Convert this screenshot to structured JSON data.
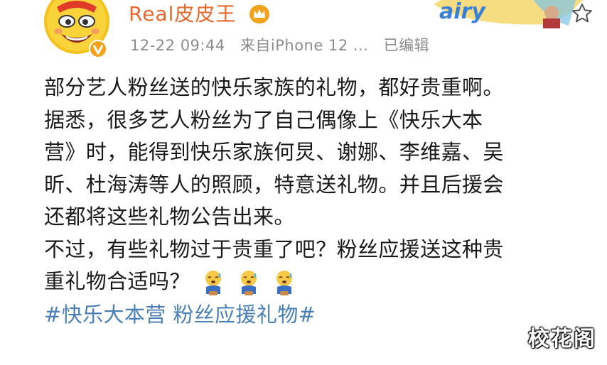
{
  "post": {
    "author": {
      "name": "Real皮皮王",
      "avatar_icon": "cartoon-face-avatar",
      "badge_icon": "verified-badge",
      "member_icon": "crown-icon",
      "name_color": "#e8692e"
    },
    "meta": {
      "datetime": "12-22 09:44",
      "source": "来自iPhone 12 ...",
      "edited": "已编辑"
    },
    "banner_text": "airy",
    "lines": [
      "部分艺人粉丝送的快乐家族的礼物，都好贵重啊。",
      "据悉，很多艺人粉丝为了自己偶像上《快乐大本",
      "营》时，能得到快乐家族何炅、谢娜、李维嘉、吴",
      "昕、杜海涛等人的照顾，特意送礼物。并且后援会",
      "还都将这些礼物公告出来。",
      "不过，有些礼物过于贵重了吧？粉丝应援送这种贵",
      "重礼物合适吗？"
    ],
    "emojis": [
      "sweating-emoji",
      "sweating-emoji",
      "sweating-emoji"
    ],
    "hashtags": "#快乐大本营 粉丝应援礼物#",
    "hashtag_color": "#4a7fb5"
  },
  "watermark": "校花阁"
}
